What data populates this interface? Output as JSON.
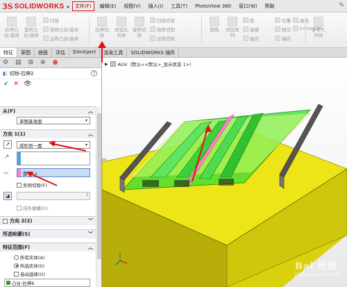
{
  "app": {
    "logo_text": "SOLIDWORKS",
    "menu": [
      "文件(F)",
      "编辑(E)",
      "视图(V)",
      "插入(I)",
      "工具(T)",
      "PhotoView 360",
      "窗口(W)",
      "帮助"
    ],
    "active_menu_index": 0
  },
  "ribbon": {
    "large_buttons": [
      {
        "label1": "拉伸凸",
        "label2": "台/基体"
      },
      {
        "label1": "旋转凸",
        "label2": "台/基体"
      },
      {
        "label1": "拉伸切",
        "label2": "除"
      },
      {
        "label1": "异型孔",
        "label2": "向导"
      },
      {
        "label1": "旋转切",
        "label2": "除"
      },
      {
        "label1": "圆角",
        "label2": ""
      },
      {
        "label1": "线性阵",
        "label2": "列"
      },
      {
        "label1": "参考几",
        "label2": "何体"
      }
    ],
    "small_buttons": [
      "扫描",
      "放样凸台/基体",
      "边界凸台/基体",
      "扫描切除",
      "放样切割",
      "边界切除",
      "筋",
      "拔模",
      "抽壳",
      "包覆",
      "相交",
      "镜向",
      "曲线",
      "Instant3D"
    ]
  },
  "tabs": [
    "特征",
    "草图",
    "曲面",
    "评估",
    "DimXpert",
    "渲染工具",
    "SOLIDWORKS 插件"
  ],
  "active_tab_index": 0,
  "panel": {
    "feature_title": "切除-拉伸2",
    "from": {
      "label": "从(F)",
      "value": "草图基准面"
    },
    "direction1": {
      "label": "方向 1(1)",
      "end_condition": "成形到一面",
      "face_value": "面<1>",
      "reverse_side_label": "反侧切除(F)",
      "draft_outward_label": "向外拔模(O)"
    },
    "direction2": {
      "label": "方向 2(2)"
    },
    "selected_contours": {
      "label": "所选轮廓(S)"
    },
    "feature_scope": {
      "label": "特征范围(F)",
      "options": [
        "所有实体(A)",
        "所选实体(S)"
      ],
      "selected_index": 1,
      "auto_select_label": "自动选择(O)",
      "body_item": "凸台-拉伸6"
    }
  },
  "viewport": {
    "breadcrumb": "AGV（默认<<默认>_显示状态 1>）"
  },
  "watermark": {
    "text": "Bai 经验",
    "sub": "jingyan.baidu.com"
  },
  "colors": {
    "accent_red": "#d71920",
    "highlight_face": "#ff80c8",
    "preview_green": "#33dd33",
    "body_yellow": "#f2ec1a"
  }
}
